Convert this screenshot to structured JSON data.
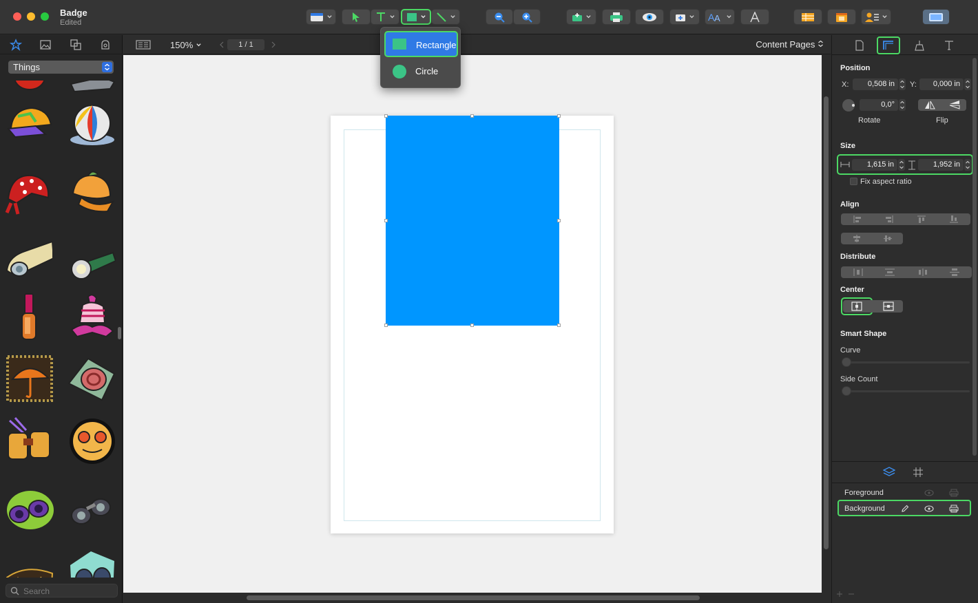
{
  "window": {
    "title": "Badge",
    "subtitle": "Edited"
  },
  "toolbar": {
    "icons": [
      "layout-icon",
      "select-arrow-icon",
      "text-tool-icon",
      "shape-tool-icon",
      "line-tool-icon",
      "zoom-out-icon",
      "zoom-in-icon",
      "insert-icon",
      "print-icon",
      "preview-icon",
      "add-field-icon",
      "text-style-icon",
      "font-icon",
      "table-icon",
      "calendar-icon",
      "contacts-icon",
      "sidebar-toggle-icon"
    ],
    "accent": "#4cd964"
  },
  "shape_menu": {
    "items": [
      {
        "label": "Rectangle",
        "icon": "rectangle-swatch-icon",
        "selected": true
      },
      {
        "label": "Circle",
        "icon": "circle-swatch-icon",
        "selected": false
      }
    ],
    "rect_color": "#3bc486",
    "circle_color": "#3bc486"
  },
  "sidebar": {
    "tabs": [
      "clipart-icon",
      "image-icon",
      "shapes-icon",
      "mask-icon"
    ],
    "category": "Things",
    "search_placeholder": "Search",
    "clipart": [
      "tomato",
      "hairdryer",
      "cap",
      "beach-ball",
      "bandana",
      "bonnet",
      "flashlight-beige",
      "flashlight-green",
      "nail-polish",
      "cupcake-cake",
      "umbrella-frame",
      "handbag",
      "binoculars-gold",
      "goggles",
      "binoculars-purple",
      "binoculars-gray",
      "sign-letters",
      "binoculars-blue"
    ]
  },
  "canvas_bar": {
    "zoom": "150%",
    "page_indicator": "1 / 1",
    "view_selector": "Content Pages"
  },
  "canvas": {
    "shape_color": "#0096ff",
    "page_color": "#ffffff"
  },
  "inspector": {
    "tabs": [
      "document-icon",
      "geometry-icon",
      "appearance-icon",
      "text-icon"
    ],
    "position": {
      "title": "Position",
      "x_label": "X:",
      "x_value": "0,508 in",
      "y_label": "Y:",
      "y_value": "0,000 in",
      "rotate_value": "0,0°",
      "rotate_label": "Rotate",
      "flip_label": "Flip"
    },
    "size": {
      "title": "Size",
      "width": "1,615 in",
      "height": "1,952 in",
      "fix_aspect_label": "Fix aspect ratio"
    },
    "align_title": "Align",
    "distribute_title": "Distribute",
    "center_title": "Center",
    "smart_shape": {
      "title": "Smart Shape",
      "curve_label": "Curve",
      "side_count_label": "Side Count"
    },
    "layers": {
      "tabs": [
        "layers-icon",
        "grid-icon"
      ],
      "items": [
        {
          "name": "Foreground",
          "selected": false
        },
        {
          "name": "Background",
          "selected": true
        }
      ]
    }
  }
}
